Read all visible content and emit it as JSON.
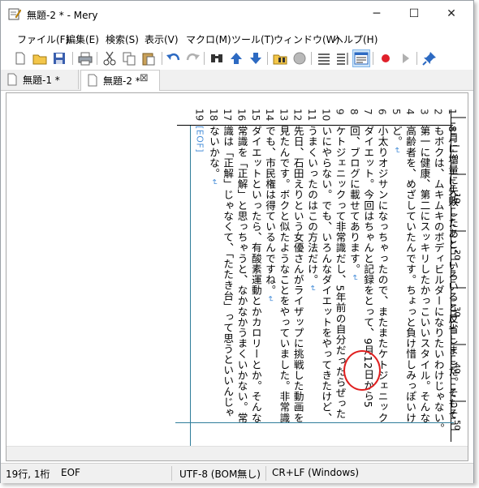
{
  "window": {
    "title": "無題-2 * - Mery",
    "minimize": "─",
    "maximize": "☐",
    "close": "✕"
  },
  "menu": [
    "ファイル(F)",
    "編集(E)",
    "検索(S)",
    "表示(V)",
    "マクロ(M)",
    "ツール(T)",
    "ウィンドウ(W)",
    "ヘルプ(H)"
  ],
  "toolbar": [
    "new-file-icon",
    "open-folder-icon",
    "save-icon",
    "print-icon",
    "cut-icon",
    "copy-icon",
    "paste-icon",
    "undo-icon",
    "redo-icon",
    "find-icon",
    "find-up-icon",
    "find-down-icon",
    "find-in-files-icon",
    "clear-highlight-icon",
    "wrap-none-icon",
    "wrap-window-icon",
    "wrap-ruler-icon",
    "record-macro-icon",
    "play-macro-icon",
    "pin-icon"
  ],
  "tabs": [
    {
      "label": "無題-1 *",
      "active": false
    },
    {
      "label": "無題-2 *",
      "active": true,
      "close": "⊠"
    }
  ],
  "ruler": {
    "ticks": [
      "10",
      "20",
      "30",
      "40",
      "50"
    ]
  },
  "gutter": [
    "1",
    "2",
    "3",
    "4",
    "5",
    "6",
    "7",
    "8",
    "9",
    "10",
    "11",
    "12",
    "13",
    "14",
    "15",
    "16",
    "17",
    "18",
    "19"
  ],
  "lines": [
    "8月に増量に失敗したあと、いろいろと反省しました。そもそ",
    "もボクは、ムキムキのボディビルダーになりたいわけじゃない。",
    "第一に健康、第二にスッキリしたかっこいいスタイル。そんな",
    "高齢者を、めざしていたんです。ちょっと負け惜しみっぽいけ",
    "ど。",
    "小太りオジサンになっちゃったので、またまたケトジェニック",
    "ダイエット。今回はちゃんと記録をとって、9月12日から5",
    "回、ブログに載せてあります。",
    "ケトジェニックって非常識だし、5年前の自分だったらぜった",
    "いにやらない。でも、いろんなダイエットをやってきたけど、",
    "うまくいったのはこの方法だけ。",
    "先日、石田えりという女優さんがライザップに挑戦した動画を",
    "見たんです。ボクと似たようなことをやっていました。非常識",
    "でも、市民権は得ているんですね。",
    "ダイエットといったら、有酸素運動とかカロリーとか。そんな",
    "常識を「正解」と思っちゃうと、なかなかうまくいかない。常",
    "識は「正解」じゃなくて、「たたき台」って思うといいんじゃ",
    "ないかな。",
    "[EOF]"
  ],
  "return_mark": "↵",
  "status": {
    "position": "19行, 1桁",
    "eof": "EOF",
    "encoding": "UTF-8 (BOM無し)",
    "newline": "CR+LF (Windows)"
  }
}
